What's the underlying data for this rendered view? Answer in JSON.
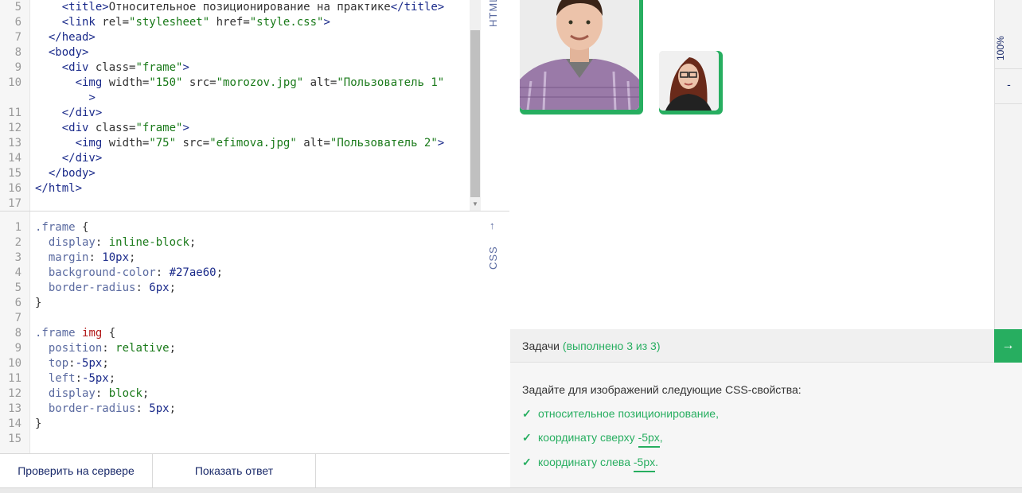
{
  "html_editor": {
    "tab_label": "HTML",
    "lines": [
      {
        "n": "5",
        "tokens": [
          [
            "t-pun",
            "    "
          ],
          [
            "t-tag",
            "<title>"
          ],
          [
            "t-pun",
            "Относительное позиционирование на практике"
          ],
          [
            "t-tag",
            "</title>"
          ]
        ]
      },
      {
        "n": "6",
        "tokens": [
          [
            "t-pun",
            "    "
          ],
          [
            "t-tag",
            "<link "
          ],
          [
            "t-attr",
            "rel="
          ],
          [
            "t-str",
            "\"stylesheet\""
          ],
          [
            "t-attr",
            " href="
          ],
          [
            "t-str",
            "\"style.css\""
          ],
          [
            "t-tag",
            ">"
          ]
        ]
      },
      {
        "n": "7",
        "tokens": [
          [
            "t-pun",
            "  "
          ],
          [
            "t-tag",
            "</head>"
          ]
        ]
      },
      {
        "n": "8",
        "tokens": [
          [
            "t-pun",
            "  "
          ],
          [
            "t-tag",
            "<body>"
          ]
        ]
      },
      {
        "n": "9",
        "tokens": [
          [
            "t-pun",
            "    "
          ],
          [
            "t-tag",
            "<div "
          ],
          [
            "t-attr",
            "class="
          ],
          [
            "t-str",
            "\"frame\""
          ],
          [
            "t-tag",
            ">"
          ]
        ]
      },
      {
        "n": "10",
        "tokens": [
          [
            "t-pun",
            "      "
          ],
          [
            "t-tag",
            "<img "
          ],
          [
            "t-attr",
            "width="
          ],
          [
            "t-str",
            "\"150\""
          ],
          [
            "t-attr",
            " src="
          ],
          [
            "t-str",
            "\"morozov.jpg\""
          ],
          [
            "t-attr",
            " alt="
          ],
          [
            "t-str",
            "\"Пользователь 1\""
          ]
        ]
      },
      {
        "n": "",
        "tokens": [
          [
            "t-pun",
            "        "
          ],
          [
            "t-tag",
            ">"
          ]
        ]
      },
      {
        "n": "11",
        "tokens": [
          [
            "t-pun",
            "    "
          ],
          [
            "t-tag",
            "</div>"
          ]
        ]
      },
      {
        "n": "12",
        "tokens": [
          [
            "t-pun",
            "    "
          ],
          [
            "t-tag",
            "<div "
          ],
          [
            "t-attr",
            "class="
          ],
          [
            "t-str",
            "\"frame\""
          ],
          [
            "t-tag",
            ">"
          ]
        ]
      },
      {
        "n": "13",
        "tokens": [
          [
            "t-pun",
            "      "
          ],
          [
            "t-tag",
            "<img "
          ],
          [
            "t-attr",
            "width="
          ],
          [
            "t-str",
            "\"75\""
          ],
          [
            "t-attr",
            " src="
          ],
          [
            "t-str",
            "\"efimova.jpg\""
          ],
          [
            "t-attr",
            " alt="
          ],
          [
            "t-str",
            "\"Пользователь 2\""
          ],
          [
            "t-tag",
            ">"
          ]
        ]
      },
      {
        "n": "14",
        "tokens": [
          [
            "t-pun",
            "    "
          ],
          [
            "t-tag",
            "</div>"
          ]
        ]
      },
      {
        "n": "15",
        "tokens": [
          [
            "t-pun",
            "  "
          ],
          [
            "t-tag",
            "</body>"
          ]
        ]
      },
      {
        "n": "16",
        "tokens": [
          [
            "t-tag",
            "</html>"
          ]
        ]
      },
      {
        "n": "17",
        "tokens": []
      }
    ]
  },
  "css_editor": {
    "tab_label": "CSS",
    "lines": [
      {
        "n": "1",
        "tokens": [
          [
            "t-sel",
            ".frame"
          ],
          [
            "t-pun",
            " {"
          ]
        ]
      },
      {
        "n": "2",
        "tokens": [
          [
            "t-pun",
            "  "
          ],
          [
            "t-prop",
            "display"
          ],
          [
            "t-pun",
            ": "
          ],
          [
            "t-val",
            "inline-block"
          ],
          [
            "t-pun",
            ";"
          ]
        ]
      },
      {
        "n": "3",
        "tokens": [
          [
            "t-pun",
            "  "
          ],
          [
            "t-prop",
            "margin"
          ],
          [
            "t-pun",
            ": "
          ],
          [
            "t-num",
            "10px"
          ],
          [
            "t-pun",
            ";"
          ]
        ]
      },
      {
        "n": "4",
        "tokens": [
          [
            "t-pun",
            "  "
          ],
          [
            "t-prop",
            "background-color"
          ],
          [
            "t-pun",
            ": "
          ],
          [
            "t-num",
            "#27ae60"
          ],
          [
            "t-pun",
            ";"
          ]
        ]
      },
      {
        "n": "5",
        "tokens": [
          [
            "t-pun",
            "  "
          ],
          [
            "t-prop",
            "border-radius"
          ],
          [
            "t-pun",
            ": "
          ],
          [
            "t-num",
            "6px"
          ],
          [
            "t-pun",
            ";"
          ]
        ]
      },
      {
        "n": "6",
        "tokens": [
          [
            "t-pun",
            "}"
          ]
        ]
      },
      {
        "n": "7",
        "tokens": []
      },
      {
        "n": "8",
        "tokens": [
          [
            "t-sel",
            ".frame "
          ],
          [
            "t-kw",
            "img"
          ],
          [
            "t-pun",
            " {"
          ]
        ]
      },
      {
        "n": "9",
        "tokens": [
          [
            "t-pun",
            "  "
          ],
          [
            "t-prop",
            "position"
          ],
          [
            "t-pun",
            ": "
          ],
          [
            "t-val",
            "relative"
          ],
          [
            "t-pun",
            ";"
          ]
        ]
      },
      {
        "n": "10",
        "tokens": [
          [
            "t-pun",
            "  "
          ],
          [
            "t-prop",
            "top"
          ],
          [
            "t-pun",
            ":"
          ],
          [
            "t-num",
            "-5px"
          ],
          [
            "t-pun",
            ";"
          ]
        ]
      },
      {
        "n": "11",
        "tokens": [
          [
            "t-pun",
            "  "
          ],
          [
            "t-prop",
            "left"
          ],
          [
            "t-pun",
            ":"
          ],
          [
            "t-num",
            "-5px"
          ],
          [
            "t-pun",
            ";"
          ]
        ]
      },
      {
        "n": "12",
        "tokens": [
          [
            "t-pun",
            "  "
          ],
          [
            "t-prop",
            "display"
          ],
          [
            "t-pun",
            ": "
          ],
          [
            "t-val",
            "block"
          ],
          [
            "t-pun",
            ";"
          ]
        ]
      },
      {
        "n": "13",
        "tokens": [
          [
            "t-pun",
            "  "
          ],
          [
            "t-prop",
            "border-radius"
          ],
          [
            "t-pun",
            ": "
          ],
          [
            "t-num",
            "5px"
          ],
          [
            "t-pun",
            ";"
          ]
        ]
      },
      {
        "n": "14",
        "tokens": [
          [
            "t-pun",
            "}"
          ]
        ]
      },
      {
        "n": "15",
        "tokens": []
      }
    ]
  },
  "buttons": {
    "check": "Проверить на сервере",
    "show": "Показать ответ"
  },
  "preview": {
    "zoom": "100%",
    "minus": "-",
    "frame_color": "#27ae60"
  },
  "tasks": {
    "title": "Задачи",
    "count": "(выполнено 3 из 3)",
    "next_arrow": "→",
    "intro": "Задайте для изображений следующие CSS-свойства:",
    "items": [
      {
        "text": "относительное позиционирование,",
        "value": ""
      },
      {
        "text": "координату сверху ",
        "value": "-5px",
        "tail": ","
      },
      {
        "text": "координату слева ",
        "value": "-5px",
        "tail": "."
      }
    ]
  }
}
